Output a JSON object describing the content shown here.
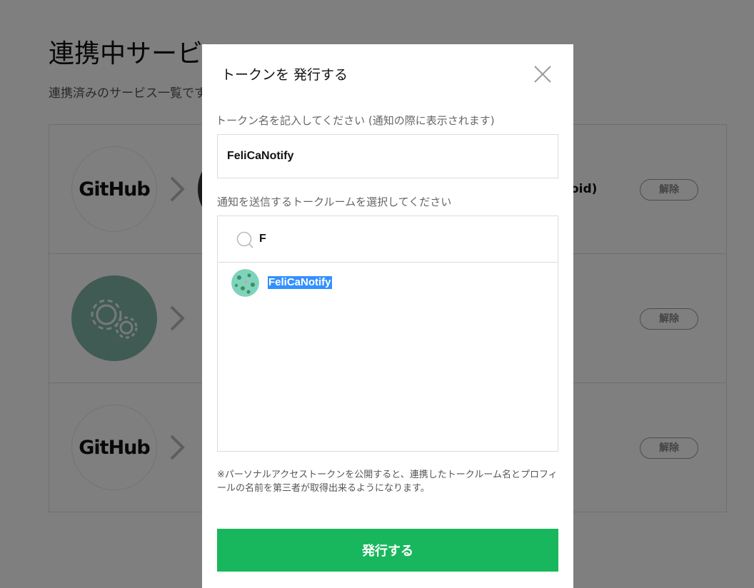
{
  "background": {
    "page_title": "連携中サービス",
    "page_desc": "連携済みのサービス一覧です",
    "services": [
      {
        "logo_text": "GitHub",
        "right_text": "oid)",
        "unlink_label": "解除"
      },
      {
        "logo_text": "",
        "right_text": "",
        "unlink_label": "解除"
      },
      {
        "logo_text": "GitHub",
        "right_text": "",
        "unlink_label": "解除"
      }
    ]
  },
  "modal": {
    "title": "トークンを 発行する",
    "token_name_label": "トークン名を記入してください (通知の際に表示されます)",
    "token_name_value": "FeliCaNotify",
    "room_label": "通知を送信するトークルームを選択してください",
    "search_value": "F",
    "rooms": [
      {
        "name": "FeliCaNotify",
        "selected": true
      }
    ],
    "notice": "※パーソナルアクセストークンを公開すると、連携したトークルーム名とプロフィールの名前を第三者が取得出来るようになります。",
    "issue_button": "発行する"
  },
  "colors": {
    "accent_green": "#19b75d",
    "selection_blue": "#3390ff",
    "overlay": "rgba(0,0,0,0.5)"
  }
}
